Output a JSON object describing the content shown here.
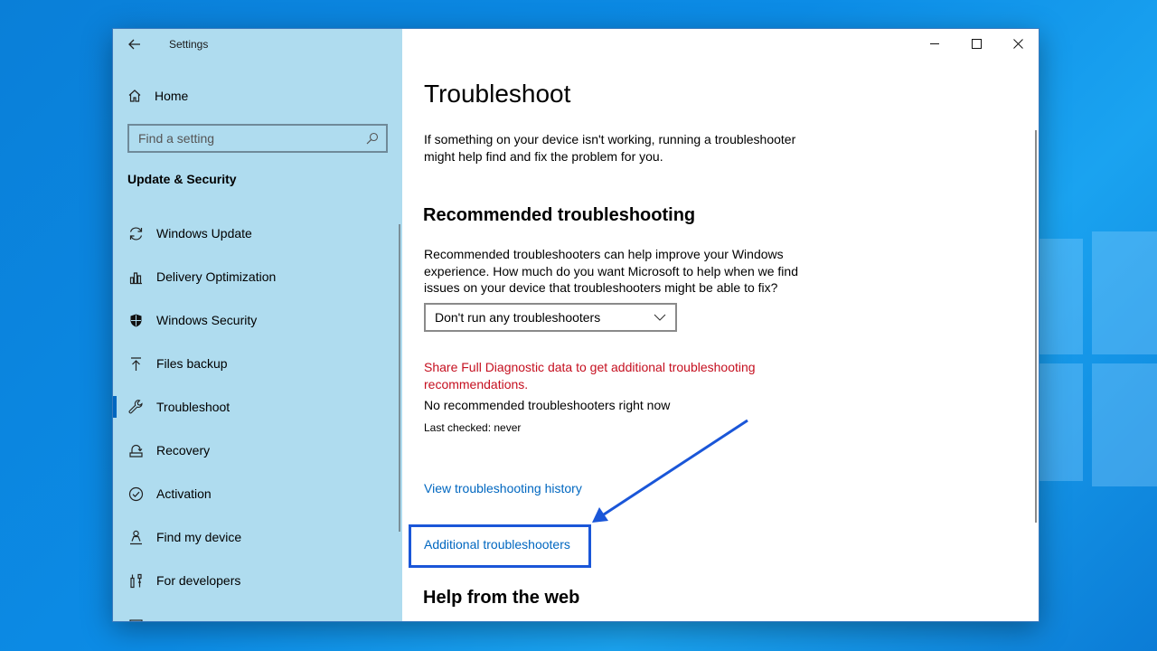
{
  "window": {
    "app_title": "Settings"
  },
  "sidebar": {
    "home_label": "Home",
    "search_placeholder": "Find a setting",
    "section_title": "Update & Security",
    "items": [
      {
        "label": "Windows Update",
        "icon": "sync-icon"
      },
      {
        "label": "Delivery Optimization",
        "icon": "delivery-optimization-icon"
      },
      {
        "label": "Windows Security",
        "icon": "shield-icon"
      },
      {
        "label": "Files backup",
        "icon": "upload-arrow-icon"
      },
      {
        "label": "Troubleshoot",
        "icon": "wrench-icon",
        "active": true
      },
      {
        "label": "Recovery",
        "icon": "recovery-icon"
      },
      {
        "label": "Activation",
        "icon": "check-circle-icon"
      },
      {
        "label": "Find my device",
        "icon": "person-pin-icon"
      },
      {
        "label": "For developers",
        "icon": "developer-tools-icon"
      }
    ]
  },
  "main": {
    "title": "Troubleshoot",
    "intro": "If something on your device isn't working, running a troubleshooter might help find and fix the problem for you.",
    "recommended_heading": "Recommended troubleshooting",
    "recommended_desc": "Recommended troubleshooters can help improve your Windows experience. How much do you want Microsoft to help when we find issues on your device that troubleshooters might be able to fix?",
    "dropdown_value": "Don't run any troubleshooters",
    "diagnostic_warning": "Share Full Diagnostic data to get additional troubleshooting recommendations.",
    "no_recommended": "No recommended troubleshooters right now",
    "last_checked": "Last checked: never",
    "history_link": "View troubleshooting history",
    "additional_link": "Additional troubleshooters",
    "help_heading": "Help from the web"
  },
  "colors": {
    "sidebar_bg": "#afdcef",
    "accent": "#0067c0",
    "warning": "#c50f1f",
    "annotation": "#1a56d8"
  }
}
